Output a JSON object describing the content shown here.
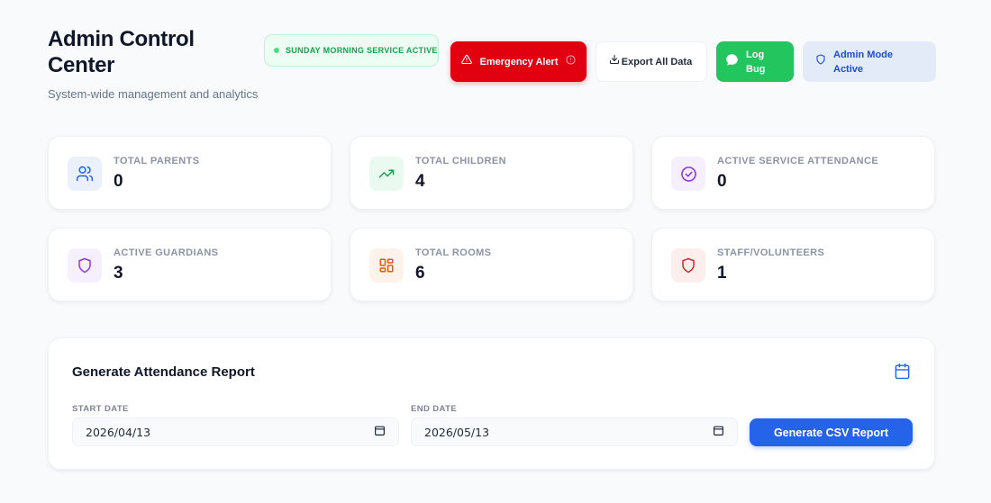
{
  "header": {
    "title": "Admin Control Center",
    "subtitle": "System-wide management and analytics"
  },
  "status_pill": {
    "text": "SUNDAY MORNING SERVICE ACTIVE"
  },
  "toolbar": {
    "emergency_label": "Emergency Alert",
    "export_label": "Export All Data",
    "bug_label": "Log Bug",
    "admin_label": "Admin Mode Active"
  },
  "stats": [
    {
      "label": "TOTAL PARENTS",
      "value": "0",
      "icon": "users-icon",
      "color": "#2563eb",
      "bg": "#eaf0fc"
    },
    {
      "label": "TOTAL CHILDREN",
      "value": "4",
      "icon": "trending-up-icon",
      "color": "#16a34a",
      "bg": "#eafaf0"
    },
    {
      "label": "ACTIVE SERVICE ATTENDANCE",
      "value": "0",
      "icon": "check-circle-icon",
      "color": "#9333ea",
      "bg": "#f6effd"
    },
    {
      "label": "ACTIVE GUARDIANS",
      "value": "3",
      "icon": "shield-icon",
      "color": "#9333ea",
      "bg": "#f6effd"
    },
    {
      "label": "TOTAL ROOMS",
      "value": "6",
      "icon": "grid-icon",
      "color": "#ea580c",
      "bg": "#fef3ea"
    },
    {
      "label": "STAFF/VOLUNTEERS",
      "value": "1",
      "icon": "shield-icon",
      "color": "#dc2626",
      "bg": "#fdeeee"
    }
  ],
  "report": {
    "title": "Generate Attendance Report",
    "start_label": "START DATE",
    "start_value": "2026/04/13",
    "end_label": "END DATE",
    "end_value": "2026/05/13",
    "generate_label": "Generate CSV Report"
  },
  "colors": {
    "emergency": "#e0000f",
    "bug": "#22c55e",
    "admin_bg": "#e3eaf8",
    "primary": "#2563eb"
  }
}
